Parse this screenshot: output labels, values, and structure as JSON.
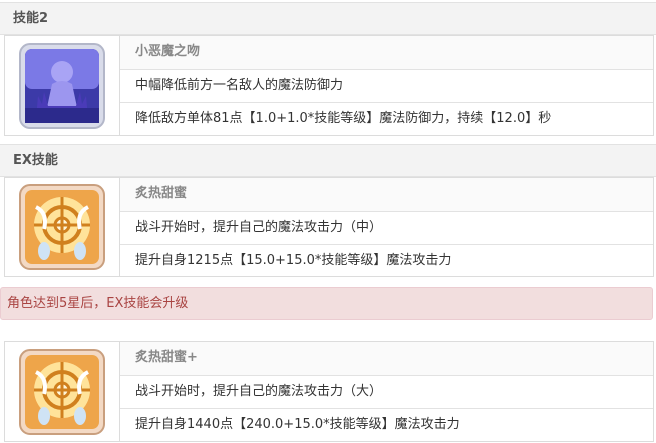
{
  "skill2": {
    "header": "技能2",
    "name": "小恶魔之吻",
    "summary": "中幅降低前方一名敌人的魔法防御力",
    "detail": "降低敌方单体81点【1.0+1.0*技能等级】魔法防御力，持续【12.0】秒",
    "icon": "demon-kiss-icon"
  },
  "ex_skill": {
    "header": "EX技能",
    "name": "炙热甜蜜",
    "summary": "战斗开始时，提升自己的魔法攻击力（中）",
    "detail": "提升自身1215点【15.0+15.0*技能等级】魔法攻击力",
    "icon": "burning-sweet-icon"
  },
  "alert": {
    "text": "角色达到5星后，EX技能会升级"
  },
  "ex_plus": {
    "name": "炙热甜蜜+",
    "summary": "战斗开始时，提升自己的魔法攻击力（大）",
    "detail": "提升自身1440点【240.0+15.0*技能等级】魔法攻击力",
    "icon": "burning-sweet-plus-icon"
  },
  "colors": {
    "header_bg": "#f3f3f3",
    "alert_bg": "#f2dede",
    "alert_text": "#a94442",
    "skill2_icon": "#6a5ccd",
    "ex_icon": "#e8943a"
  }
}
